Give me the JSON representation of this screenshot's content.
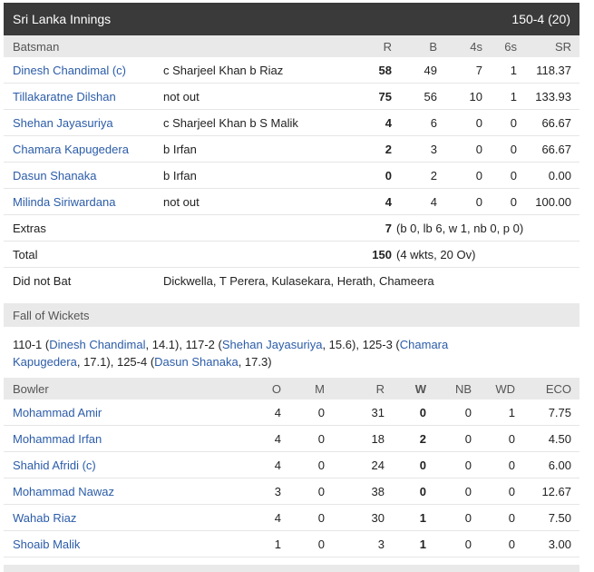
{
  "header": {
    "title": "Sri Lanka Innings",
    "score": "150-4 (20)"
  },
  "batting": {
    "columns": {
      "batsman": "Batsman",
      "r": "R",
      "b": "B",
      "fours": "4s",
      "sixes": "6s",
      "sr": "SR"
    },
    "rows": [
      {
        "name": "Dinesh Chandimal (c)",
        "dismissal": "c Sharjeel Khan b Riaz",
        "r": "58",
        "b": "49",
        "fours": "7",
        "sixes": "1",
        "sr": "118.37"
      },
      {
        "name": "Tillakaratne Dilshan",
        "dismissal": "not out",
        "r": "75",
        "b": "56",
        "fours": "10",
        "sixes": "1",
        "sr": "133.93"
      },
      {
        "name": "Shehan Jayasuriya",
        "dismissal": "c Sharjeel Khan b S Malik",
        "r": "4",
        "b": "6",
        "fours": "0",
        "sixes": "0",
        "sr": "66.67"
      },
      {
        "name": "Chamara Kapugedera",
        "dismissal": "b Irfan",
        "r": "2",
        "b": "3",
        "fours": "0",
        "sixes": "0",
        "sr": "66.67"
      },
      {
        "name": "Dasun Shanaka",
        "dismissal": "b Irfan",
        "r": "0",
        "b": "2",
        "fours": "0",
        "sixes": "0",
        "sr": "0.00"
      },
      {
        "name": "Milinda Siriwardana",
        "dismissal": "not out",
        "r": "4",
        "b": "4",
        "fours": "0",
        "sixes": "0",
        "sr": "100.00"
      }
    ],
    "extras": {
      "label": "Extras",
      "value": "7",
      "detail": "(b 0, lb 6, w 1, nb 0, p 0)"
    },
    "total": {
      "label": "Total",
      "value": "150",
      "detail": "(4 wkts, 20 Ov)"
    },
    "dnb": {
      "label": "Did not Bat",
      "value": "Dickwella, T Perera, Kulasekara, Herath, Chameera"
    }
  },
  "fall_of_wickets": {
    "title": "Fall of Wickets",
    "entries": [
      {
        "score": "110-1",
        "name": "Dinesh Chandimal",
        "over": "14.1"
      },
      {
        "score": "117-2",
        "name": "Shehan Jayasuriya",
        "over": "15.6"
      },
      {
        "score": "125-3",
        "name": "Chamara Kapugedera",
        "over": "17.1"
      },
      {
        "score": "125-4",
        "name": "Dasun Shanaka",
        "over": "17.3"
      }
    ]
  },
  "bowling": {
    "columns": {
      "bowler": "Bowler",
      "o": "O",
      "m": "M",
      "r": "R",
      "w": "W",
      "nb": "NB",
      "wd": "WD",
      "eco": "ECO"
    },
    "rows": [
      {
        "name": "Mohammad Amir",
        "o": "4",
        "m": "0",
        "r": "31",
        "w": "0",
        "nb": "0",
        "wd": "1",
        "eco": "7.75"
      },
      {
        "name": "Mohammad Irfan",
        "o": "4",
        "m": "0",
        "r": "18",
        "w": "2",
        "nb": "0",
        "wd": "0",
        "eco": "4.50"
      },
      {
        "name": "Shahid Afridi (c)",
        "o": "4",
        "m": "0",
        "r": "24",
        "w": "0",
        "nb": "0",
        "wd": "0",
        "eco": "6.00"
      },
      {
        "name": "Mohammad Nawaz",
        "o": "3",
        "m": "0",
        "r": "38",
        "w": "0",
        "nb": "0",
        "wd": "0",
        "eco": "12.67"
      },
      {
        "name": "Wahab Riaz",
        "o": "4",
        "m": "0",
        "r": "30",
        "w": "1",
        "nb": "0",
        "wd": "0",
        "eco": "7.50"
      },
      {
        "name": "Shoaib Malik",
        "o": "1",
        "m": "0",
        "r": "3",
        "w": "1",
        "nb": "0",
        "wd": "0",
        "eco": "3.00"
      }
    ]
  }
}
